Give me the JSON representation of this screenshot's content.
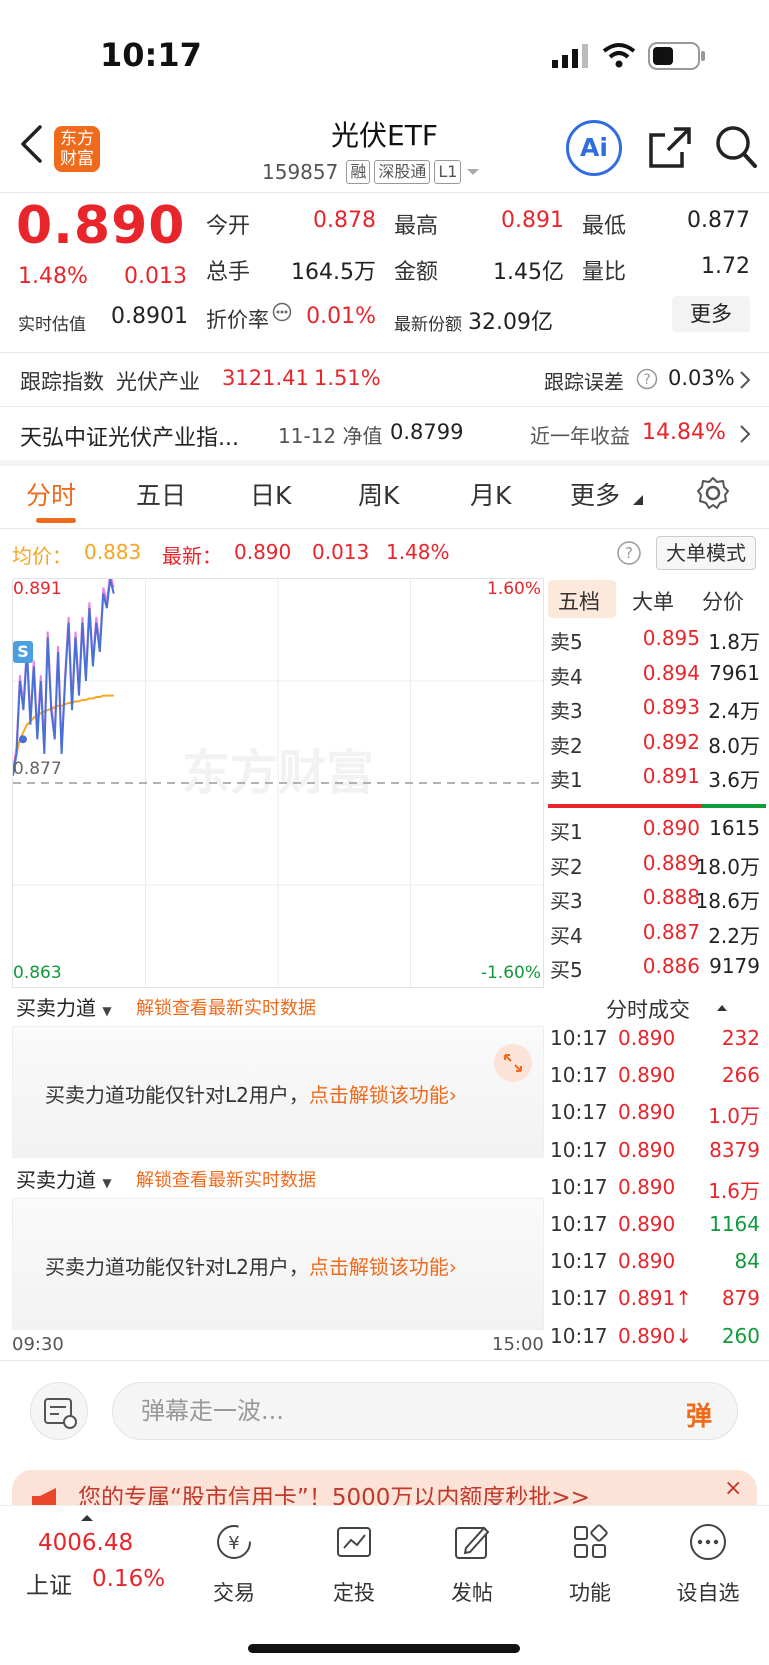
{
  "status_bar": {
    "time": "10:17"
  },
  "header": {
    "title": "光伏ETF",
    "code": "159857",
    "tags": [
      "融",
      "深股通",
      "L1"
    ],
    "logo_text": "东方财富",
    "ai_label": "Ai"
  },
  "quote": {
    "price": "0.890",
    "change_pct": "1.48%",
    "change": "0.013",
    "rows": [
      [
        {
          "label": "今开",
          "value": "0.878",
          "color": "red"
        },
        {
          "label": "最高",
          "value": "0.891",
          "color": "red"
        },
        {
          "label": "最低",
          "value": "0.877",
          "color": "black"
        }
      ],
      [
        {
          "label": "总手",
          "value": "164.5万",
          "color": "black"
        },
        {
          "label": "金额",
          "value": "1.45亿",
          "color": "black"
        },
        {
          "label": "量比",
          "value": "1.72",
          "color": "black"
        }
      ]
    ],
    "estimate_label": "实时估值",
    "estimate_value": "0.8901",
    "discount_label": "折价率",
    "discount_value": "0.01%",
    "shares_label": "最新份额",
    "shares_value": "32.09亿",
    "more_label": "更多"
  },
  "tracking": {
    "index_label": "跟踪指数",
    "index_name": "光伏产业",
    "index_value": "3121.41",
    "index_pct": "1.51%",
    "error_label": "跟踪误差",
    "error_value": "0.03%"
  },
  "fund": {
    "name": "天弘中证光伏产业指...",
    "nav_label": "11-12 净值",
    "nav_value": "0.8799",
    "yield_label": "近一年收益",
    "yield_value": "14.84%"
  },
  "tabs": [
    "分时",
    "五日",
    "日K",
    "周K",
    "月K",
    "更多"
  ],
  "chart_header": {
    "avg_label": "均价：",
    "avg_value": "0.883",
    "latest_label": "最新：",
    "latest_value": "0.890",
    "latest_change": "0.013",
    "latest_pct": "1.48%",
    "big_order_label": "大单模式"
  },
  "chart_data": {
    "type": "line",
    "y_max": "0.891",
    "y_min": "0.863",
    "y_ref": "0.877",
    "pct_max": "1.60%",
    "pct_min": "-1.60%",
    "x_start": "09:30",
    "x_end": "15:00",
    "watermark": "东方财富",
    "marker": "S",
    "ylim": [
      0.863,
      0.891
    ],
    "series": [
      {
        "values": [
          0.8775,
          0.879,
          0.884,
          0.882,
          0.886,
          0.881,
          0.885,
          0.88,
          0.884,
          0.879,
          0.887,
          0.882,
          0.88,
          0.886,
          0.879,
          0.884,
          0.888,
          0.882,
          0.887,
          0.883,
          0.888,
          0.884,
          0.889,
          0.885,
          0.888,
          0.886,
          0.89,
          0.889,
          0.891,
          0.89
        ]
      },
      {
        "values": [
          0.878,
          0.879,
          0.88,
          0.8805,
          0.881,
          0.8812,
          0.8815,
          0.8816,
          0.8818,
          0.8819,
          0.882,
          0.8821,
          0.8822,
          0.8823,
          0.8823,
          0.8824,
          0.8825,
          0.8825,
          0.8826,
          0.8826,
          0.8827,
          0.8827,
          0.8828,
          0.8828,
          0.8829,
          0.8829,
          0.883,
          0.883,
          0.883,
          0.883
        ]
      }
    ],
    "colors": {
      "price": "#4a6fd6",
      "avg": "#f5a623"
    }
  },
  "order_book": {
    "tabs": [
      "五档",
      "大单",
      "分价"
    ],
    "sells": [
      {
        "label": "卖5",
        "price": "0.895",
        "vol": "1.8万"
      },
      {
        "label": "卖4",
        "price": "0.894",
        "vol": "7961"
      },
      {
        "label": "卖3",
        "price": "0.893",
        "vol": "2.4万"
      },
      {
        "label": "卖2",
        "price": "0.892",
        "vol": "8.0万"
      },
      {
        "label": "卖1",
        "price": "0.891",
        "vol": "3.6万"
      }
    ],
    "buys": [
      {
        "label": "买1",
        "price": "0.890",
        "vol": "1615"
      },
      {
        "label": "买2",
        "price": "0.889",
        "vol": "18.0万"
      },
      {
        "label": "买3",
        "price": "0.888",
        "vol": "18.6万"
      },
      {
        "label": "买4",
        "price": "0.887",
        "vol": "2.2万"
      },
      {
        "label": "买5",
        "price": "0.886",
        "vol": "9179"
      }
    ],
    "buy_ratio": 0.7
  },
  "ticks": {
    "title": "分时成交",
    "rows": [
      {
        "time": "10:17",
        "price": "0.890",
        "vol": "232",
        "color": "red"
      },
      {
        "time": "10:17",
        "price": "0.890",
        "vol": "266",
        "color": "red"
      },
      {
        "time": "10:17",
        "price": "0.890",
        "vol": "1.0万",
        "color": "red"
      },
      {
        "time": "10:17",
        "price": "0.890",
        "vol": "8379",
        "color": "red"
      },
      {
        "time": "10:17",
        "price": "0.890",
        "vol": "1.6万",
        "color": "red"
      },
      {
        "time": "10:17",
        "price": "0.890",
        "vol": "1164",
        "color": "green"
      },
      {
        "time": "10:17",
        "price": "0.890",
        "vol": "84",
        "color": "green"
      },
      {
        "time": "10:17",
        "price": "0.891↑",
        "vol": "879",
        "color": "red"
      },
      {
        "time": "10:17",
        "price": "0.890↓",
        "vol": "260",
        "color": "green"
      }
    ]
  },
  "panels": [
    {
      "select": "买卖力道",
      "unlock": "解锁查看最新实时数据",
      "msg": "买卖力道功能仅针对L2用户，",
      "link": "点击解锁该功能"
    },
    {
      "select": "买卖力道",
      "unlock": "解锁查看最新实时数据",
      "msg": "买卖力道功能仅针对L2用户，",
      "link": "点击解锁该功能"
    }
  ],
  "comment": {
    "placeholder": "弹幕走一波...",
    "danmu_label": "弹"
  },
  "banner": {
    "text": "您的专属“股市信用卡”！5000万以内额度秒批>>"
  },
  "tabbar": {
    "index_value": "4006.48",
    "index_name": "上证",
    "index_pct": "0.16%",
    "items": [
      "交易",
      "定投",
      "发帖",
      "功能",
      "设自选"
    ]
  }
}
